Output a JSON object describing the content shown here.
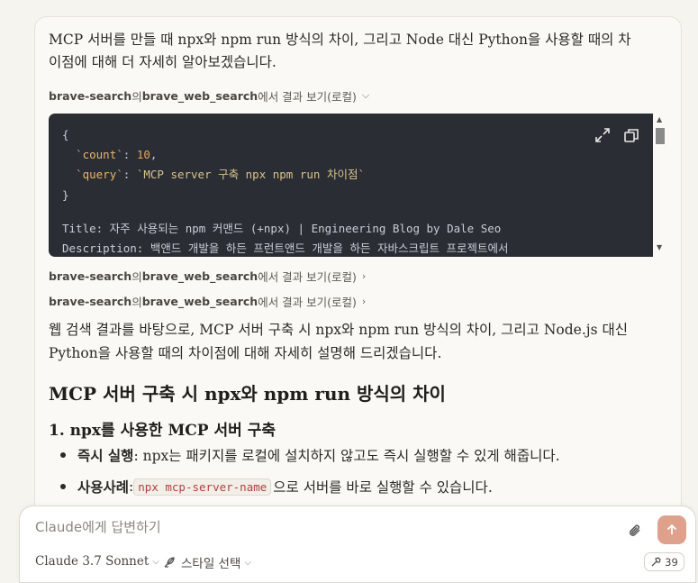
{
  "user_message": "MCP 서버를 만들 때 npx와 npm run 방식의 차이, 그리고 Node 대신 Python을 사용할 때의 차이점에 대해 더 자세히 알아보겠습니다.",
  "tool_calls": [
    {
      "server": "brave-search",
      "mid": "의 ",
      "tool": "brave_web_search",
      "suffix": "에서 결과 보기(로컬)",
      "chevron": "⌵"
    },
    {
      "server": "brave-search",
      "mid": "의 ",
      "tool": "brave_web_search",
      "suffix": "에서 결과 보기(로컬)",
      "chevron": "›"
    },
    {
      "server": "brave-search",
      "mid": "의 ",
      "tool": "brave_web_search",
      "suffix": "에서 결과 보기(로컬)",
      "chevron": "›"
    }
  ],
  "code": {
    "open_brace": "{",
    "count_key": "`count`",
    "count_colon": ": ",
    "count_value": "10",
    "count_comma": ",",
    "query_key": "`query`",
    "query_colon": ": ",
    "query_value": "`MCP server 구축 npx npm run 차이점`",
    "close_brace": "}",
    "result_title": "Title: 자주 사용되는 npm 커맨드 (+npx) | Engineering Blog by Dale Seo",
    "result_desc": "Description: 백앤드 개발을 하든 프런트앤드 개발을 하든 자바스크립트 프로젝트에서"
  },
  "answer": {
    "intro": "웹 검색 결과를 바탕으로, MCP 서버 구축 시 npx와 npm run 방식의 차이, 그리고 Node.js 대신 Python을 사용할 때의 차이점에 대해 자세히 설명해 드리겠습니다.",
    "heading": "MCP 서버 구축 시 npx와 npm run 방식의 차이",
    "subheading": "1. npx를 사용한 MCP 서버 구축",
    "bullets": [
      {
        "label": "즉시 실행",
        "text": ": npx는 패키지를 로컬에 설치하지 않고도 즉시 실행할 수 있게 해줍니다."
      },
      {
        "label": "사용사례",
        "text": ": ",
        "code": "npx mcp-server-name",
        "rest": "으로 서버를 바로 실행할 수 있습니다."
      }
    ]
  },
  "composer": {
    "placeholder": "Claude에게 답변하기",
    "model": "Claude 3.7 Sonnet",
    "style": "스타일 선택",
    "tools_count": "39"
  }
}
